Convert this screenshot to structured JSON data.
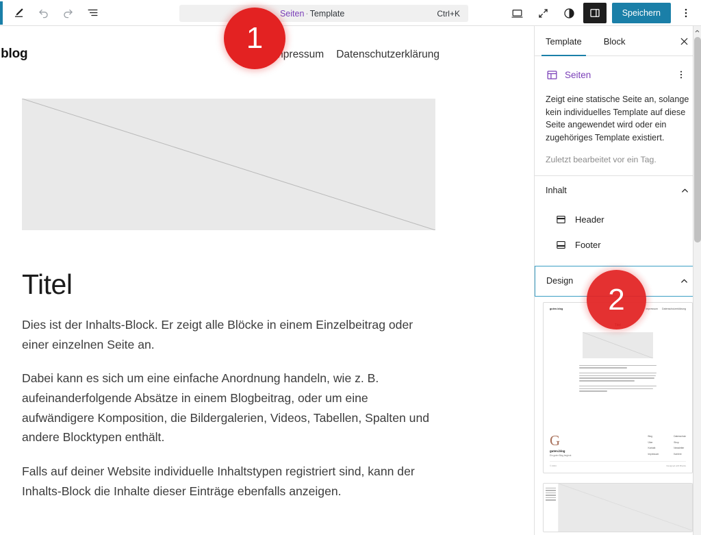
{
  "toolbar": {
    "edit_tooltip": "Bearbeiten",
    "undo_tooltip": "Rückgängig",
    "redo_tooltip": "Wiederholen",
    "listview_tooltip": "Listenansicht",
    "view_tooltip": "Ansicht",
    "fullscreen_tooltip": "Vollbild",
    "styles_tooltip": "Stile",
    "settings_tooltip": "Einstellungen",
    "save_label": "Speichern",
    "options_tooltip": "Optionen"
  },
  "command_bar": {
    "breadcrumb": "Seiten",
    "separator": "·",
    "title": "Template",
    "shortcut": "Ctrl+K"
  },
  "canvas": {
    "site_logo": ".blog",
    "nav": [
      "Impressum",
      "Datenschutzerklärung"
    ],
    "post_title": "Titel",
    "paragraphs": [
      "Dies ist der Inhalts-Block. Er zeigt alle Blöcke in einem Einzelbeitrag oder einer einzelnen Seite an.",
      "Dabei kann es sich um eine einfache Anordnung handeln, wie z. B. aufeinanderfolgende Absätze in einem Blogbeitrag, oder um eine aufwändigere Komposition, die Bildergalerien, Videos, Tabellen, Spalten und andere Blocktypen enthält.",
      "Falls auf deiner Website individuelle Inhaltstypen registriert sind, kann der Inhalts-Block die Inhalte dieser Einträge ebenfalls anzeigen."
    ]
  },
  "sidebar": {
    "tabs": [
      {
        "label": "Template",
        "active": true
      },
      {
        "label": "Block",
        "active": false
      }
    ],
    "close_label": "Schließen",
    "template_name": "Seiten",
    "template_description": "Zeigt eine statische Seite an, solange kein individuelles Template auf diese Seite angewendet wird oder ein zugehöriges Template existiert.",
    "last_edited": "Zuletzt bearbeitet vor ein Tag.",
    "content_panel": {
      "label": "Inhalt",
      "expanded": true,
      "items": [
        {
          "label": "Header",
          "icon": "header-icon"
        },
        {
          "label": "Footer",
          "icon": "footer-icon"
        }
      ]
    },
    "design_panel": {
      "label": "Design",
      "expanded": true,
      "focused": true
    }
  },
  "thumbnail": {
    "logo": "guten.blog",
    "nav": [
      "Impressum",
      "Datenschutzerklärung"
    ],
    "title": "Titel",
    "footer_glyph": "G",
    "footer_brand": "guten.blog",
    "footer_tagline": "Ein guter Blog beginnt",
    "footer_cols": [
      [
        "Blog",
        "Über",
        "Kontakt",
        "Impressum"
      ],
      [
        "Datenschutz",
        "Shop",
        "Newsletter",
        "Karriere"
      ]
    ],
    "footer_left": "© 2024",
    "footer_right": "Designed with Blocks"
  },
  "annotations": [
    {
      "id": "1",
      "label": "1"
    },
    {
      "id": "2",
      "label": "2"
    }
  ],
  "colors": {
    "accent": "#1a7fa8",
    "template_purple": "#7a3fb8",
    "badge_red": "#e32222",
    "logo_brown": "#a8705a"
  }
}
